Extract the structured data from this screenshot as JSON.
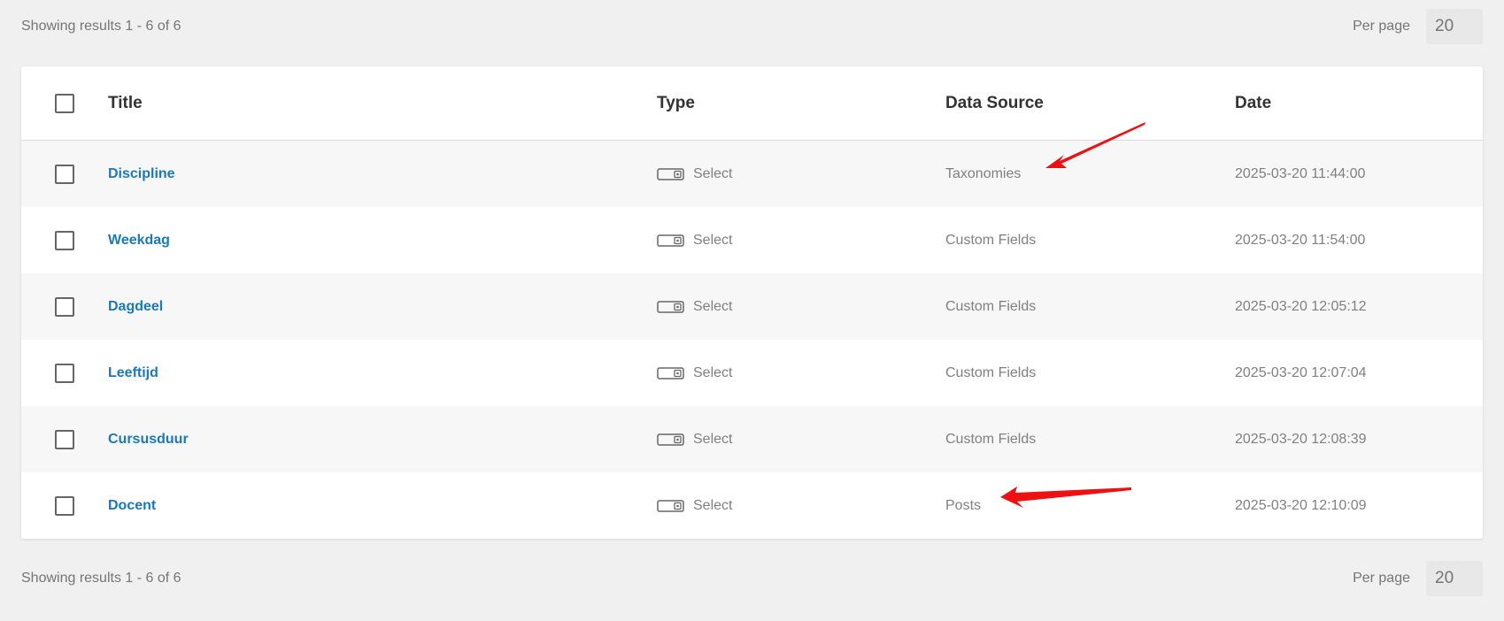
{
  "summary": {
    "results_text": "Showing results 1 - 6 of 6",
    "per_page_label": "Per page",
    "per_page_value": "20"
  },
  "table": {
    "columns": {
      "title": "Title",
      "type": "Type",
      "data_source": "Data Source",
      "date": "Date"
    },
    "rows": [
      {
        "title": "Discipline",
        "type": "Select",
        "type_icon": "select-field-icon",
        "data_source": "Taxonomies",
        "date": "2025-03-20 11:44:00"
      },
      {
        "title": "Weekdag",
        "type": "Select",
        "type_icon": "select-field-icon",
        "data_source": "Custom Fields",
        "date": "2025-03-20 11:54:00"
      },
      {
        "title": "Dagdeel",
        "type": "Select",
        "type_icon": "select-field-icon",
        "data_source": "Custom Fields",
        "date": "2025-03-20 12:05:12"
      },
      {
        "title": "Leeftijd",
        "type": "Select",
        "type_icon": "select-field-icon",
        "data_source": "Custom Fields",
        "date": "2025-03-20 12:07:04"
      },
      {
        "title": "Cursusduur",
        "type": "Select",
        "type_icon": "select-field-icon",
        "data_source": "Custom Fields",
        "date": "2025-03-20 12:08:39"
      },
      {
        "title": "Docent",
        "type": "Select",
        "type_icon": "select-field-icon",
        "data_source": "Posts",
        "date": "2025-03-20 12:10:09"
      }
    ]
  },
  "annotations": {
    "arrow_color": "#ee1111",
    "arrow_icon": "red-arrow-icon"
  },
  "colors": {
    "link": "#1a7ab8",
    "muted_text": "#808080",
    "background": "#f0f0f0",
    "row_alt": "#f7f7f7"
  }
}
